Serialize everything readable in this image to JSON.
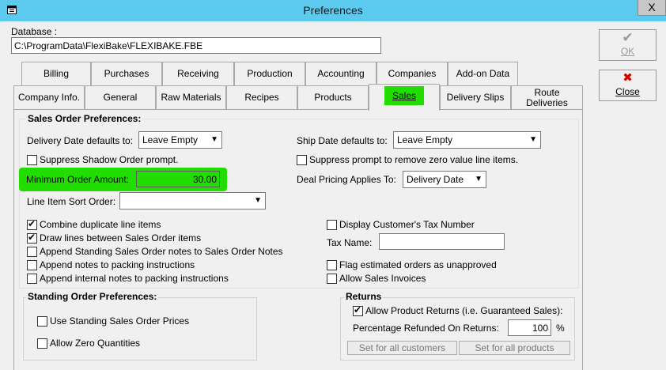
{
  "window": {
    "title": "Preferences",
    "close": "X"
  },
  "database": {
    "label": "Database :",
    "value": "C:\\ProgramData\\FlexiBake\\FLEXIBAKE.FBE"
  },
  "buttons": {
    "ok": "OK",
    "close": "Close",
    "ok_glyph": "✔",
    "close_glyph": "✖"
  },
  "tabs_row1": [
    "Billing",
    "Purchases",
    "Receiving",
    "Production",
    "Accounting",
    "Companies",
    "Add-on Data"
  ],
  "tabs_row2": [
    "Company Info.",
    "General",
    "Raw Materials",
    "Recipes",
    "Products",
    "Sales",
    "Delivery Slips",
    "Route\nDeliveries"
  ],
  "active_tab": "Sales",
  "sales": {
    "group_title": "Sales Order Preferences:",
    "delivery_date_label": "Delivery Date defaults to:",
    "delivery_date_value": "Leave Empty",
    "ship_date_label": "Ship Date defaults to:",
    "ship_date_value": "Leave Empty",
    "suppress_shadow": "Suppress Shadow Order prompt.",
    "suppress_zero": "Suppress prompt to remove zero value line items.",
    "min_order_label": "Minimum Order Amount:",
    "min_order_value": "30.00",
    "deal_pricing_label": "Deal Pricing Applies To:",
    "deal_pricing_value": "Delivery Date",
    "sort_label": "Line Item Sort Order:",
    "sort_value": "",
    "combine": "Combine duplicate line items",
    "draw_lines": "Draw lines between Sales Order items",
    "append_standing": "Append Standing Sales Order notes to Sales Order Notes",
    "append_packing": "Append notes to packing instructions",
    "append_internal": "Append internal notes to packing instructions",
    "display_tax": "Display Customer's Tax Number",
    "tax_name_label": "Tax Name:",
    "tax_name_value": "",
    "flag_estimated": "Flag estimated orders as unapproved",
    "allow_invoices": "Allow Sales Invoices"
  },
  "standing": {
    "title": "Standing Order Preferences:",
    "use_prices": "Use Standing Sales Order Prices",
    "allow_zero": "Allow Zero Quantities"
  },
  "returns": {
    "title": "Returns",
    "allow": "Allow Product Returns (i.e. Guaranteed Sales):",
    "pct_label": "Percentage Refunded On Returns:",
    "pct_value": "100",
    "pct_unit": "%",
    "all_customers": "Set for all customers",
    "all_products": "Set for all products"
  },
  "highlight_color": "#22dd00"
}
